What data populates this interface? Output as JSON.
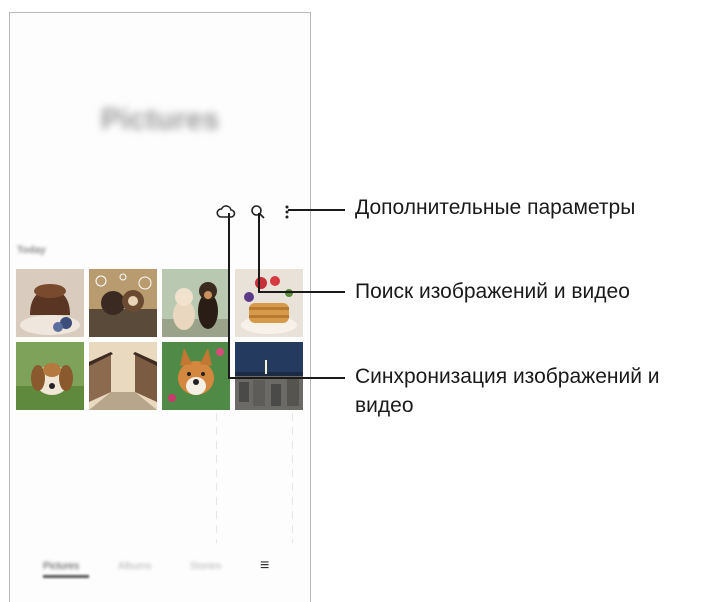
{
  "screen": {
    "title": "Pictures",
    "section_today": "Today"
  },
  "toolbar": {
    "icons": [
      "cloud-icon",
      "search-icon",
      "more-options-icon"
    ]
  },
  "bottom_nav": {
    "items": [
      "Pictures",
      "Albums",
      "Stories"
    ],
    "active": "Pictures",
    "menu_icon": "hamburger-menu-icon"
  },
  "thumbnails": [
    {
      "subject": "chocolate cake"
    },
    {
      "subject": "dogs with bubbles"
    },
    {
      "subject": "puppy and kitten"
    },
    {
      "subject": "pancakes with berries"
    },
    {
      "subject": "beagle"
    },
    {
      "subject": "village street"
    },
    {
      "subject": "corgi"
    },
    {
      "subject": "night city"
    }
  ],
  "callouts": {
    "more_options": "Дополнительные параметры",
    "search": "Поиск изображений и видео",
    "sync_line1": "Синхронизация изображений и",
    "sync_line2": "видео"
  },
  "colors": {
    "callout_line": "#1a1a1a",
    "frame_border": "#b8b8b8"
  }
}
